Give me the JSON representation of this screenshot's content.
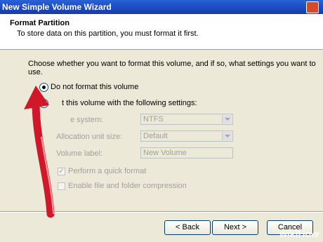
{
  "window": {
    "title": "New Simple Volume Wizard"
  },
  "header": {
    "title": "Format Partition",
    "subtitle": "To store data on this partition, you must format it first."
  },
  "instructions": "Choose whether you want to format this volume, and if so, what settings you want to use.",
  "options": {
    "no_format": {
      "label": "Do not format this volume",
      "selected": true
    },
    "format": {
      "label_tail": "t this volume with the following settings:",
      "selected": false
    }
  },
  "settings": {
    "filesystem": {
      "label_tail": "e system:",
      "value": "NTFS"
    },
    "allocation": {
      "label": "Allocation unit size:",
      "value": "Default"
    },
    "volume_label": {
      "label": "Volume label:",
      "value": "New Volume"
    },
    "quick_format": {
      "label": "Perform a quick format",
      "checked": true
    },
    "compression": {
      "label": "Enable file and folder compression",
      "checked": false
    }
  },
  "buttons": {
    "back": "< Back",
    "next": "Next >",
    "cancel": "Cancel"
  },
  "watermark": {
    "prefix": "wiki",
    "suffix": "How"
  },
  "colors": {
    "title_bar": "#1d4cc4",
    "arrow": "#d0182a",
    "dialog_bg": "#ece9d8"
  }
}
